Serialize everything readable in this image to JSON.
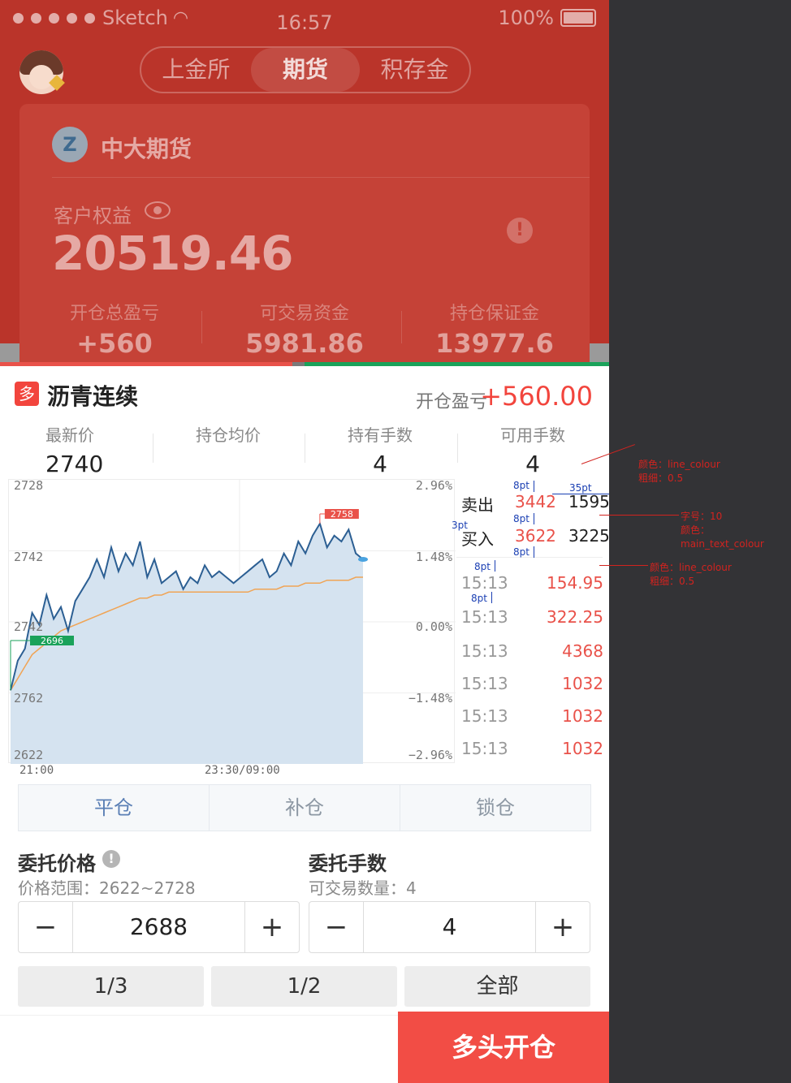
{
  "status_bar": {
    "carrier": "Sketch",
    "time": "16:57",
    "battery": "100%"
  },
  "segments": [
    {
      "label": "上金所"
    },
    {
      "label": "期货"
    },
    {
      "label": "积存金"
    }
  ],
  "account": {
    "broker": "中大期货",
    "equity_label": "客户权益",
    "equity_value": "20519.46",
    "stats": [
      {
        "label": "开仓总盈亏",
        "value": "+560"
      },
      {
        "label": "可交易资金",
        "value": "5981.86"
      },
      {
        "label": "持仓保证金",
        "value": "13977.6"
      }
    ]
  },
  "instrument": {
    "tag": "多",
    "name": "沥青连续",
    "pnl_label": "开仓盈亏",
    "pnl_value": "+560.00"
  },
  "metrics": [
    {
      "label": "最新价",
      "value": "2740"
    },
    {
      "label": "持仓均价",
      "value": ""
    },
    {
      "label": "持有手数",
      "value": "4"
    },
    {
      "label": "可用手数",
      "value": "4"
    }
  ],
  "chart_data": {
    "type": "line",
    "y_left_ticks": [
      "2728",
      "2742",
      "2742",
      "2762",
      "2622"
    ],
    "y_right_ticks": [
      "2.96%",
      "1.48%",
      "0.00%",
      "−1.48%",
      "−2.96%"
    ],
    "x_ticks": [
      "21:00",
      "23:30/09:00"
    ],
    "high_marker": "2758",
    "low_marker": "2696",
    "series": [
      {
        "values": [
          2702,
          2712,
          2716,
          2728,
          2724,
          2734,
          2726,
          2730,
          2722,
          2732,
          2736,
          2740,
          2746,
          2740,
          2750,
          2742,
          2748,
          2744,
          2752,
          2740,
          2746,
          2738,
          2740,
          2742,
          2736,
          2740,
          2738,
          2744,
          2740,
          2742,
          2740,
          2738,
          2740,
          2742,
          2744,
          2746,
          2740,
          2742,
          2748,
          2744,
          2752,
          2748,
          2754,
          2758,
          2750,
          2754,
          2752,
          2756,
          2748,
          2746
        ]
      },
      {
        "values": [
          2702,
          2706,
          2710,
          2714,
          2716,
          2718,
          2720,
          2722,
          2723,
          2724,
          2725,
          2726,
          2727,
          2728,
          2729,
          2730,
          2731,
          2732,
          2733,
          2733,
          2734,
          2734,
          2735,
          2735,
          2735,
          2735,
          2735,
          2735,
          2735,
          2735,
          2735,
          2735,
          2735,
          2735,
          2736,
          2736,
          2736,
          2736,
          2737,
          2737,
          2737,
          2738,
          2738,
          2738,
          2739,
          2739,
          2739,
          2739,
          2740,
          2740
        ]
      }
    ],
    "ylim": [
      2680,
      2770
    ]
  },
  "order_book": [
    {
      "side": "卖出",
      "price": "3442",
      "qty": "1595"
    },
    {
      "side": "买入",
      "price": "3622",
      "qty": "3225"
    }
  ],
  "ticks": [
    {
      "time": "15:13",
      "value": "154.95"
    },
    {
      "time": "15:13",
      "value": "322.25"
    },
    {
      "time": "15:13",
      "value": "4368"
    },
    {
      "time": "15:13",
      "value": "1032"
    },
    {
      "time": "15:13",
      "value": "1032"
    },
    {
      "time": "15:13",
      "value": "1032"
    }
  ],
  "actions": [
    {
      "label": "平仓"
    },
    {
      "label": "补仓"
    },
    {
      "label": "锁仓"
    }
  ],
  "order": {
    "price_title": "委托价格",
    "price_range": "价格范围：2622~2728",
    "price_value": "2688",
    "qty_title": "委托手数",
    "qty_available": "可交易数量：4",
    "qty_value": "4",
    "minus": "−",
    "plus": "+",
    "fractions": [
      "1/3",
      "1/2",
      "全部"
    ],
    "submit": "多头开仓"
  },
  "annotations": {
    "a1_l1": "颜色：line_colour",
    "a1_l2": "粗细：0.5",
    "a2_l1": "字号：10",
    "a2_l2": "颜色：main_text_colour",
    "a3_l1": "颜色：line_colour",
    "a3_l2": "粗细：0.5",
    "d_8pt": "8pt",
    "d_35pt": "35pt",
    "d_3pt": "3pt"
  },
  "colors": {
    "brand_red": "#f24d45",
    "chart_line": "#2c5f93",
    "avg_line": "#f0a455",
    "chart_fill": "#d5e3f0"
  }
}
